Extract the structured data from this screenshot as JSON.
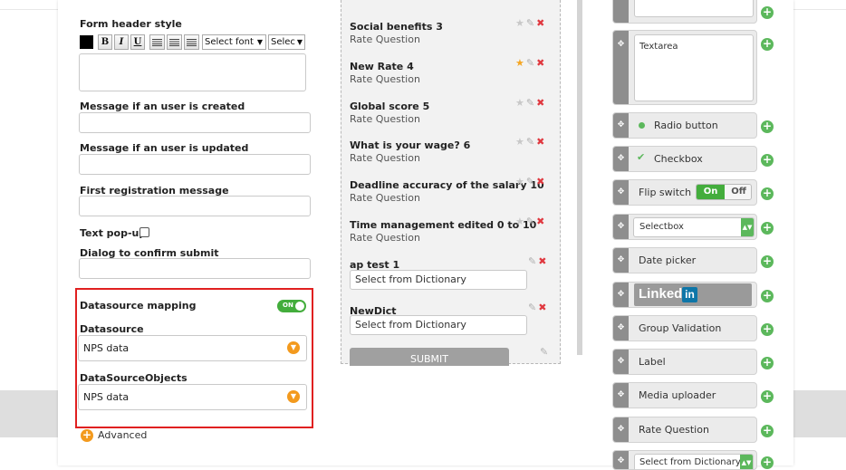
{
  "form_settings": {
    "form_header_style_label": "Form header style",
    "toolbar": {
      "bold": "B",
      "italic": "I",
      "underline": "U",
      "font_select": "Select font",
      "size_select": "Selec"
    },
    "message_user_created_label": "Message if an user is created",
    "message_user_updated_label": "Message if an user is updated",
    "first_registration_label": "First registration message",
    "text_popup_label": "Text pop-up",
    "dialog_confirm_label": "Dialog to confirm submit",
    "datasource_mapping_label": "Datasource mapping",
    "datasource_mapping_toggle": "ON",
    "datasource_label": "Datasource",
    "datasource_value": "NPS data",
    "datasource_objects_label": "DataSourceObjects",
    "datasource_objects_value": "NPS data",
    "advanced_label": "Advanced"
  },
  "form_canvas": {
    "questions": [
      {
        "title": "Social benefits 3",
        "type": "Rate Question"
      },
      {
        "title": "New Rate 4",
        "type": "Rate Question"
      },
      {
        "title": "Global score 5",
        "type": "Rate Question"
      },
      {
        "title": "What is your wage? 6",
        "type": "Rate Question"
      },
      {
        "title": "Deadline accuracy of the salary 10",
        "type": "Rate Question"
      },
      {
        "title": "Time management edited 0 to 10",
        "type": "Rate Question"
      },
      {
        "title": "ap test 1",
        "input": "Select from Dictionary"
      },
      {
        "title": "NewDict",
        "input": "Select from Dictionary"
      }
    ],
    "submit_label": "SUBMIT"
  },
  "palette": {
    "items": [
      "Textarea",
      "Radio button",
      "Checkbox",
      "Flip switch",
      "Selectbox",
      "Date picker",
      "Linked",
      "Group Validation",
      "Label",
      "Media uploader",
      "Rate Question",
      "Select from Dictionary"
    ],
    "flip_on": "On",
    "flip_off": "Off",
    "linkedin_badge": "in"
  },
  "colors": {
    "accent_green": "#5cb85c",
    "toggle_green": "#43ad3c",
    "accent_orange": "#f39a1e",
    "highlight_red": "#e02020",
    "delete_red": "#e0383f"
  },
  "icons": {
    "star": "star-icon",
    "edit": "pencil-icon",
    "delete": "close-icon",
    "drag": "move-icon",
    "add": "plus-icon",
    "dropdown": "chevron-down-icon"
  }
}
